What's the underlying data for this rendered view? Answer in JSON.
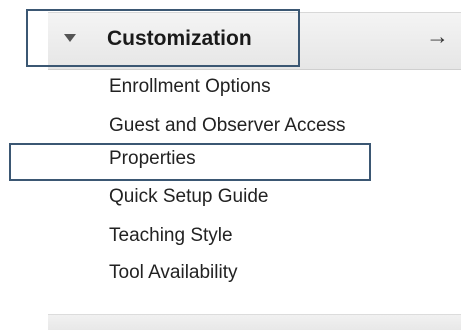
{
  "section": {
    "title": "Customization",
    "arrow_icon": "right-arrow-icon",
    "caret_icon": "caret-down-icon",
    "expanded": true
  },
  "menu": {
    "items": [
      {
        "label": "Enrollment Options"
      },
      {
        "label": "Guest and Observer Access"
      },
      {
        "label": "Properties"
      },
      {
        "label": "Quick Setup Guide"
      },
      {
        "label": "Teaching Style"
      },
      {
        "label": "Tool Availability"
      }
    ],
    "highlighted_item": "Properties"
  },
  "colors": {
    "highlight_outline": "#3b5773",
    "header_background": "#efefef",
    "text": "#222222"
  }
}
